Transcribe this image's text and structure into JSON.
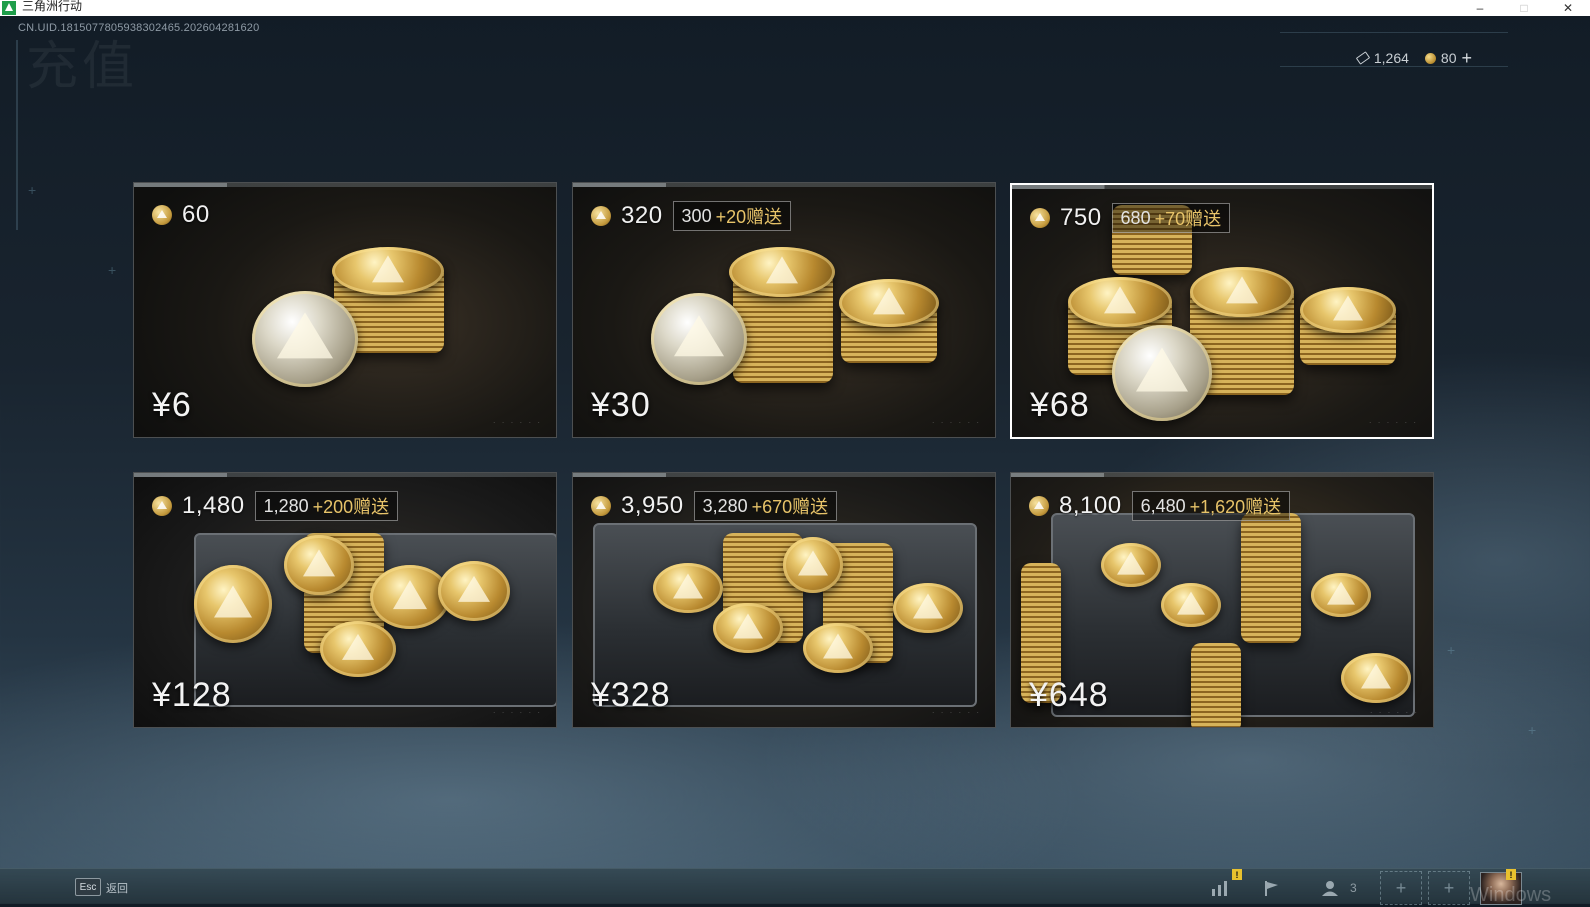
{
  "window": {
    "title": "三角洲行动",
    "minimize": "–",
    "maximize": "□",
    "close": "✕"
  },
  "hud": {
    "uid": "CN.UID.181507780593830​2465.202604281620",
    "page_title_bg": "充值"
  },
  "currency": {
    "tickets": "1,264",
    "coins": "80",
    "add": "+"
  },
  "packs": [
    {
      "amount": "60",
      "bonus_base": "",
      "bonus_extra": "",
      "price": "¥6"
    },
    {
      "amount": "320",
      "bonus_base": "300",
      "bonus_extra": "+20赠送",
      "price": "¥30"
    },
    {
      "amount": "750",
      "bonus_base": "680",
      "bonus_extra": "+70赠送",
      "price": "¥68"
    },
    {
      "amount": "1,480",
      "bonus_base": "1,280",
      "bonus_extra": "+200赠送",
      "price": "¥128"
    },
    {
      "amount": "3,950",
      "bonus_base": "3,280",
      "bonus_extra": "+670赠送",
      "price": "¥328"
    },
    {
      "amount": "8,100",
      "bonus_base": "6,480",
      "bonus_extra": "+1,620赠送",
      "price": "¥648"
    }
  ],
  "bottom": {
    "esc": "Esc",
    "back": "返回",
    "friends_count": "3",
    "notice": "!",
    "slot_plus": "+",
    "watermark": "Windows"
  },
  "colors": {
    "bonus_extra": "#e7c369",
    "selected_border": "#ffffff",
    "badge": "#e8c12e"
  }
}
